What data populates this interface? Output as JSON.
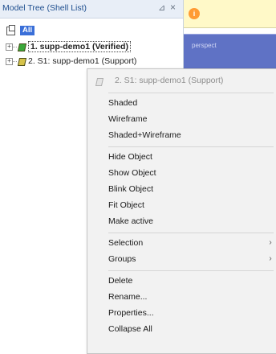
{
  "panel": {
    "title": "Model Tree (Shell List)",
    "pin_icon": "⊿",
    "close_icon": "×",
    "root_label": "All",
    "tree": [
      {
        "expander": "+",
        "label": "1. supp-demo1 (Verified)",
        "icon_color": "#3aa83a"
      },
      {
        "expander": "+",
        "label": "2. S1: supp-demo1 (Support)",
        "icon_color": "#d6c34a"
      }
    ]
  },
  "info_bar": {
    "icon_glyph": "i"
  },
  "viewport": {
    "label": "perspect",
    "background": "#5f72c5"
  },
  "context_menu": {
    "header": "2. S1: supp-demo1 (Support)",
    "items": [
      {
        "label": "Shaded"
      },
      {
        "label": "Wireframe"
      },
      {
        "label": "Shaded+Wireframe"
      },
      {
        "label": "Hide Object"
      },
      {
        "label": "Show Object"
      },
      {
        "label": "Blink Object"
      },
      {
        "label": "Fit Object"
      },
      {
        "label": "Make active"
      },
      {
        "label": "Selection",
        "submenu": "›"
      },
      {
        "label": "Groups",
        "submenu": "›"
      },
      {
        "label": "Delete"
      },
      {
        "label": "Rename..."
      },
      {
        "label": "Properties..."
      },
      {
        "label": "Collapse All"
      }
    ]
  }
}
